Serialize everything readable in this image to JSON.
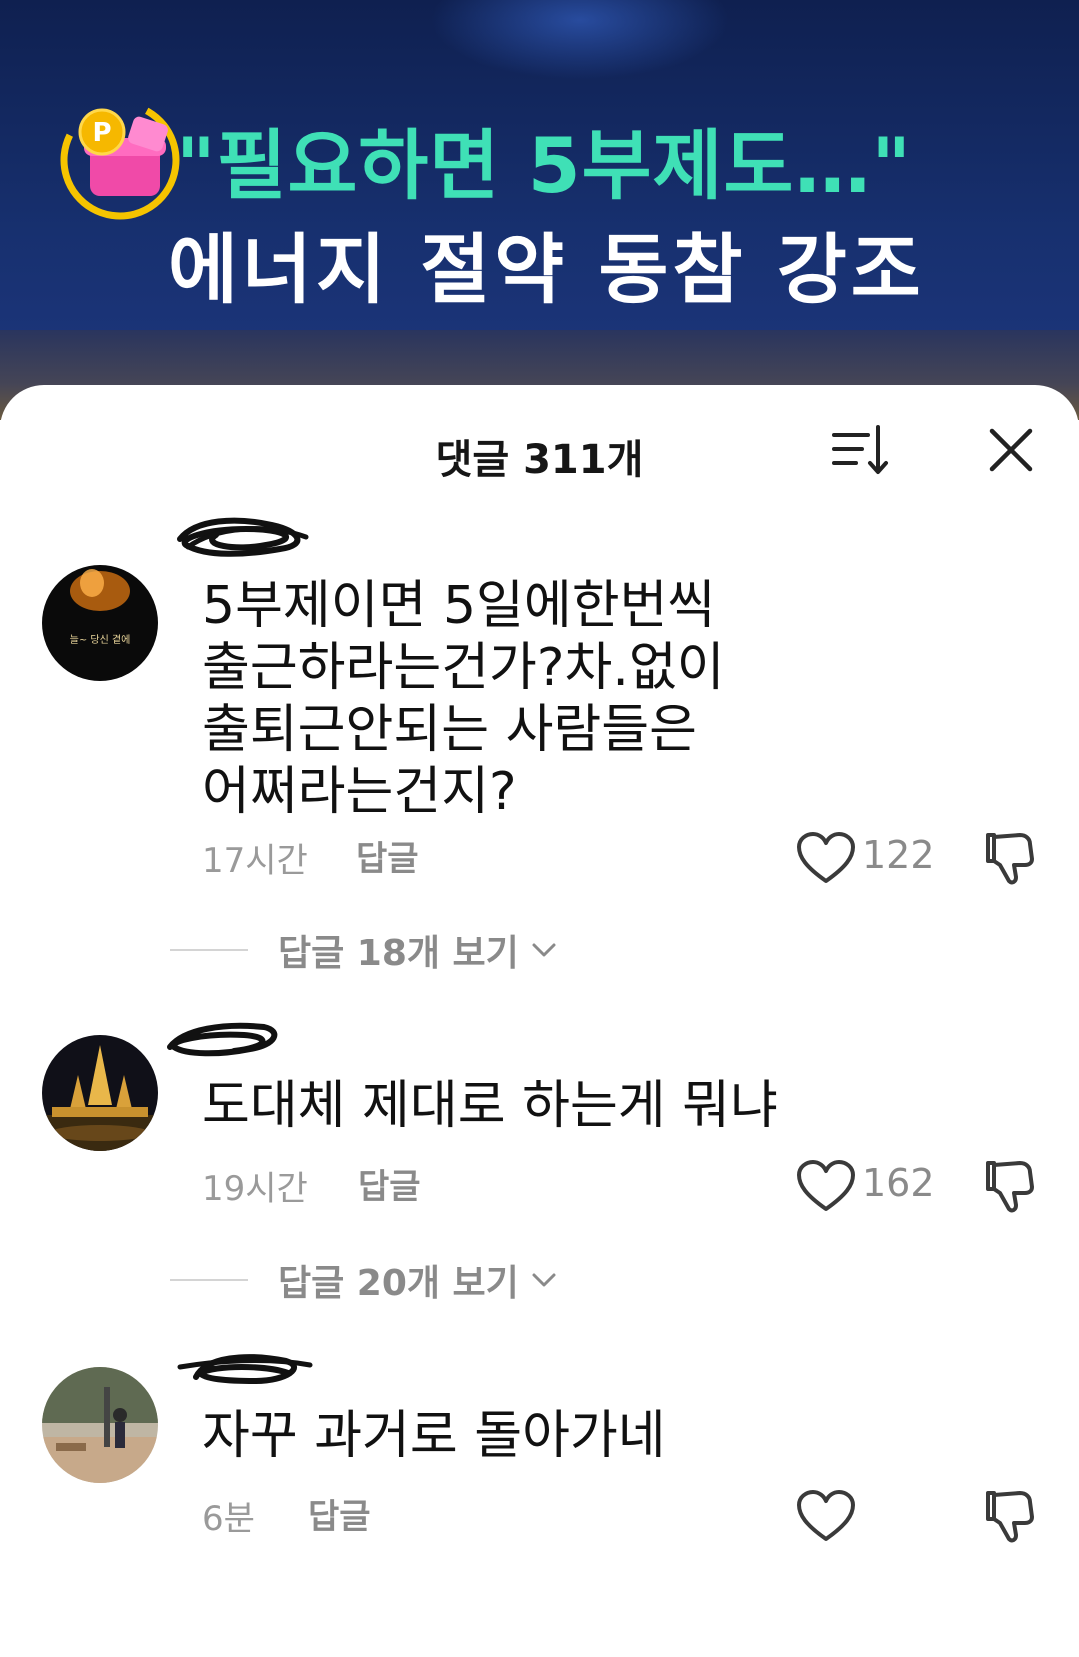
{
  "video": {
    "headline_line1": "\"필요하면 5부제도…\"",
    "headline_line2": "에너지 절약 동참 강조",
    "badge_letter": "P"
  },
  "sheet": {
    "title": "댓글 311개"
  },
  "comments": [
    {
      "text": "5부제이면 5일에한번씩\n출근하라는건가?차.없이\n출퇴근안되는 사람들은\n어쩌라는건지?",
      "time": "17시간",
      "reply_label": "답글",
      "likes": "122",
      "view_replies": "답글 18개 보기",
      "avatar_caption": "늘~ 당신 곁에"
    },
    {
      "text": "도대체 제대로 하는게 뭐냐",
      "time": "19시간",
      "reply_label": "답글",
      "likes": "162",
      "view_replies": "답글 20개 보기"
    },
    {
      "text": "자꾸 과거로 돌아가네",
      "time": "6분",
      "reply_label": "답글",
      "likes": ""
    }
  ],
  "icons": {
    "sort": "sort-icon",
    "close": "close-icon",
    "like": "heart-icon",
    "dislike": "thumbs-down-icon",
    "expand": "chevron-down-icon"
  },
  "colors": {
    "headline_accent": "#3fe0b6",
    "banner_bg": "#17306f",
    "meta_text": "#8a8a8a"
  }
}
